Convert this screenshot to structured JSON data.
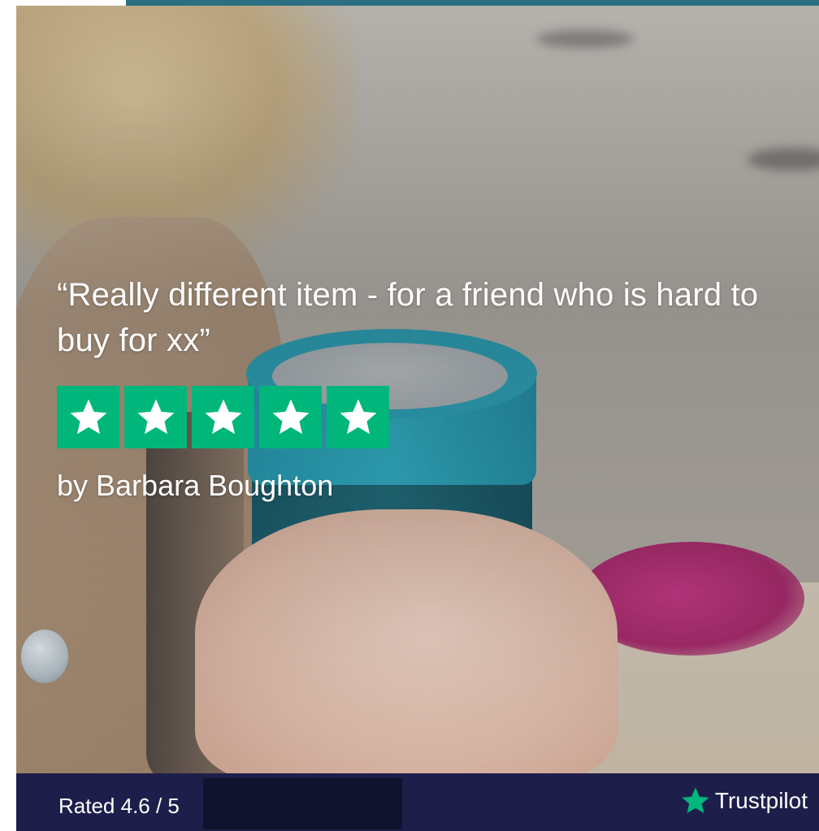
{
  "review": {
    "quote": "“Really different item - for a friend who is hard to buy for xx”",
    "author": "by Barbara Boughton",
    "stars": 5
  },
  "footer": {
    "rating_text": "Rated 4.6 / 5",
    "brand": "Trustpilot"
  },
  "colors": {
    "star_green": "#00b67a",
    "footer_bg": "#1e1e4b",
    "top_accent": "#2a6f82"
  },
  "icons": {
    "star": "star-icon",
    "trustpilot": "trustpilot-star-icon"
  }
}
